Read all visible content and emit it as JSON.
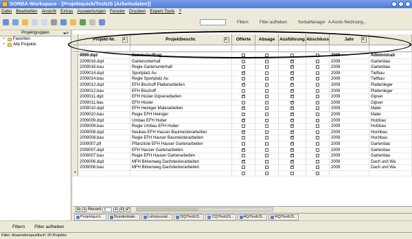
{
  "window": {
    "title": "SORBA Workspace - [Projektquick/TestUS (Arbeitsdaten)]"
  },
  "menu": [
    "Datei",
    "Bearbeiten",
    "Ansicht",
    "Extras",
    "Auswertungen",
    "Fenster",
    "Drucken",
    "Expert-Tools",
    "?"
  ],
  "toolbar": {
    "filter_label": "Filtern",
    "filter_off_label": "Filter aufheben",
    "manager_label": "SorbaManager",
    "akonto_label": "A-Konto Rechnung..."
  },
  "sidebar": {
    "header": "Projektgruppen",
    "items": [
      {
        "label": "Favoriten"
      },
      {
        "label": "Alle Projekte"
      }
    ]
  },
  "grid": {
    "columns": [
      "Projekt-Nr.",
      "Projektbeschr.",
      "Offerte",
      "Absage",
      "Ausführung",
      "Abschluss",
      "Jahr",
      ""
    ],
    "rows": [
      {
        "nr": "9999.dqd",
        "desc": "Sammelauftrag",
        "offerte": false,
        "absage": false,
        "ausf": false,
        "abschl": false,
        "jahr": "2009",
        "kat": "Administrati",
        "bold": true
      },
      {
        "nr": "2009016.dqd",
        "desc": "Gartenunterhalt",
        "offerte": false,
        "absage": false,
        "ausf": true,
        "abschl": false,
        "jahr": "2009",
        "kat": "Gartenbau",
        "bold": false
      },
      {
        "nr": "2009016.bau",
        "desc": "Regie Gartenunterhalt",
        "offerte": false,
        "absage": false,
        "ausf": true,
        "abschl": false,
        "jahr": "2009",
        "kat": "Gartenbau",
        "bold": false
      },
      {
        "nr": "2009014.dqd",
        "desc": "Sportplatz Au",
        "offerte": true,
        "absage": false,
        "ausf": true,
        "abschl": false,
        "jahr": "2009",
        "kat": "Tiefbau",
        "bold": false
      },
      {
        "nr": "2009014.bau",
        "desc": "Regie Sportplatz Au",
        "offerte": false,
        "absage": false,
        "ausf": true,
        "abschl": false,
        "jahr": "2009",
        "kat": "Tiefbau",
        "bold": false
      },
      {
        "nr": "2009012.dqd",
        "desc": "EFH Bischoff Plattenarbeiten",
        "offerte": true,
        "absage": false,
        "ausf": true,
        "abschl": false,
        "jahr": "2009",
        "kat": "Plattenleger",
        "bold": false
      },
      {
        "nr": "2009012.bau",
        "desc": "EFH Bischoff",
        "offerte": false,
        "absage": false,
        "ausf": true,
        "abschl": false,
        "jahr": "2009",
        "kat": "Plattenleger",
        "bold": false
      },
      {
        "nr": "2009011.dqd",
        "desc": "EFH Hüsler Gipserarbeiten",
        "offerte": true,
        "absage": false,
        "ausf": true,
        "abschl": false,
        "jahr": "2009",
        "kat": "Gipser",
        "bold": false
      },
      {
        "nr": "2009011.bau",
        "desc": "EFH Hüsler",
        "offerte": false,
        "absage": false,
        "ausf": true,
        "abschl": false,
        "jahr": "2009",
        "kat": "Gipser",
        "bold": false
      },
      {
        "nr": "2009010.dqd",
        "desc": "EFH Heiniger Malerarbeiten",
        "offerte": true,
        "absage": false,
        "ausf": true,
        "abschl": false,
        "jahr": "2009",
        "kat": "Maler",
        "bold": false
      },
      {
        "nr": "2009010.bau",
        "desc": "Regie EFH Heiniger",
        "offerte": false,
        "absage": false,
        "ausf": true,
        "abschl": false,
        "jahr": "2009",
        "kat": "Maler",
        "bold": false
      },
      {
        "nr": "2009009.dqd",
        "desc": "Umbau EFH Huber",
        "offerte": true,
        "absage": false,
        "ausf": true,
        "abschl": false,
        "jahr": "2009",
        "kat": "Holzbau",
        "bold": false
      },
      {
        "nr": "2009009.bau",
        "desc": "Regie Umbau EFH Huber",
        "offerte": false,
        "absage": false,
        "ausf": true,
        "abschl": false,
        "jahr": "2009",
        "kat": "Holzbau",
        "bold": false
      },
      {
        "nr": "2009008.dqd",
        "desc": "Neubau EFH Hauser Baumeisterarbeiten",
        "offerte": true,
        "absage": false,
        "ausf": true,
        "abschl": false,
        "jahr": "2009",
        "kat": "Hochbau",
        "bold": false
      },
      {
        "nr": "2009008.bau",
        "desc": "Regie EFH Hauser Baumeisterarbeiten",
        "offerte": false,
        "absage": false,
        "ausf": true,
        "abschl": false,
        "jahr": "2009",
        "kat": "Hochbau",
        "bold": false
      },
      {
        "nr": "2009007.pfl",
        "desc": "Pflanzliste EFH Hauser Gartenarbeiten",
        "offerte": false,
        "absage": false,
        "ausf": true,
        "abschl": false,
        "jahr": "2009",
        "kat": "Gartenbau",
        "bold": false
      },
      {
        "nr": "2009007.dqd",
        "desc": "EFH Hauser Gartenarbeiten",
        "offerte": true,
        "absage": false,
        "ausf": true,
        "abschl": false,
        "jahr": "2009",
        "kat": "Gartenbau",
        "bold": false
      },
      {
        "nr": "2009007.bau",
        "desc": "Regie EFH Hauser Gartenarbeiten",
        "offerte": false,
        "absage": false,
        "ausf": true,
        "abschl": false,
        "jahr": "2009",
        "kat": "Gartenbau",
        "bold": false
      },
      {
        "nr": "2009006.dqd",
        "desc": "MFH Birkenweg Dachdeckerarbeiten",
        "offerte": true,
        "absage": false,
        "ausf": true,
        "abschl": false,
        "jahr": "2009",
        "kat": "Dach und Wa",
        "bold": false
      },
      {
        "nr": "2009006.bau",
        "desc": "MFH Birkenweg Dachdeckerarbeiten",
        "offerte": false,
        "absage": false,
        "ausf": true,
        "abschl": false,
        "jahr": "2009",
        "kat": "Dach und Wa",
        "bold": false
      }
    ],
    "new_row_marker": "*"
  },
  "navigator": {
    "label": "Record",
    "value": "1"
  },
  "tabs": [
    "Projektquick...",
    "Stundenkate...",
    "Lohnjournal...",
    "DQ/TestUS...",
    "CQ/TestUS...",
    "AQ/TestUS...",
    "RQ/TestUS..."
  ],
  "bottom": {
    "filter": "Filtern",
    "filter_off": "Filter aufheben"
  },
  "status": {
    "text": "Filter: Anwenderspezifisch: 20 Projekte"
  },
  "colors": {
    "title_bar": "#4f7bd6",
    "chrome": "#ECE9D8"
  }
}
